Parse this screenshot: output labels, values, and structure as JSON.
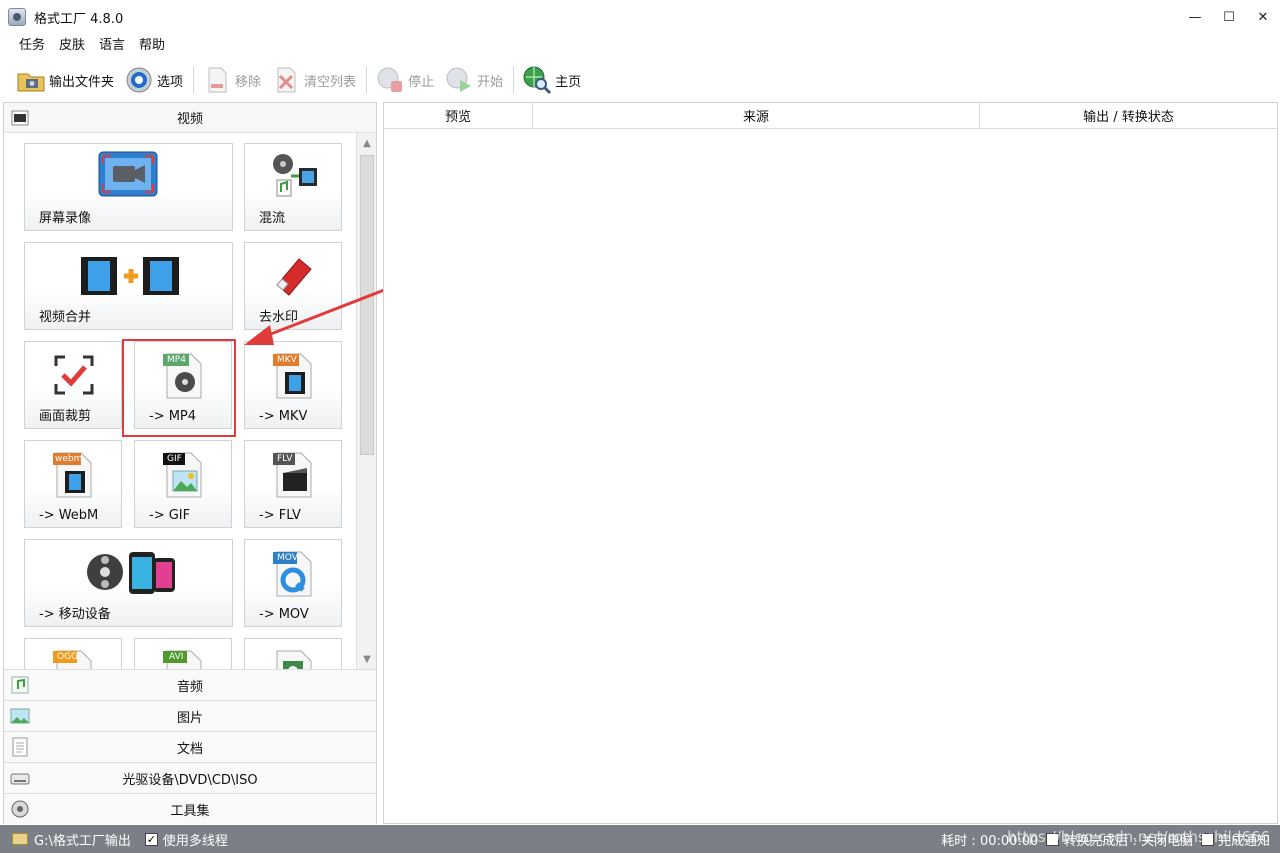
{
  "window": {
    "title": "格式工厂 4.8.0",
    "minimize": "—",
    "maximize": "☐",
    "close": "✕"
  },
  "menu": [
    "任务",
    "皮肤",
    "语言",
    "帮助"
  ],
  "toolbar": {
    "output_folder": "输出文件夹",
    "options": "选项",
    "remove": "移除",
    "clear_list": "清空列表",
    "stop": "停止",
    "start": "开始",
    "home": "主页"
  },
  "left": {
    "video_label": "视频",
    "tiles": {
      "screen_record": "屏幕录像",
      "mux": "混流",
      "video_merge": "视频合并",
      "remove_watermark": "去水印",
      "crop": "画面裁剪",
      "mp4": "-> MP4",
      "mkv": "-> MKV",
      "webm": "-> WebM",
      "gif": "-> GIF",
      "flv": "-> FLV",
      "mobile": "-> 移动设备",
      "mov": "-> MOV"
    },
    "badges": {
      "mp4": "MP4",
      "mkv": "MKV",
      "webm": "webm",
      "gif": "GIF",
      "flv": "FLV",
      "mov": "MOV",
      "ogg": "OGG",
      "avi": "AVI"
    },
    "categories": [
      "音频",
      "图片",
      "文档",
      "光驱设备\\DVD\\CD\\ISO",
      "工具集"
    ]
  },
  "table": {
    "columns": [
      "预览",
      "来源",
      "输出 / 转换状态"
    ]
  },
  "status": {
    "output_path": "G:\\格式工厂输出",
    "multithread": "使用多线程",
    "elapsed": "耗时 : 00:00:00",
    "shutdown": "转换完成后 : 关闭电脑",
    "notify": "完成通知"
  },
  "watermark": "https://blog.csdn.net/rothschild666"
}
